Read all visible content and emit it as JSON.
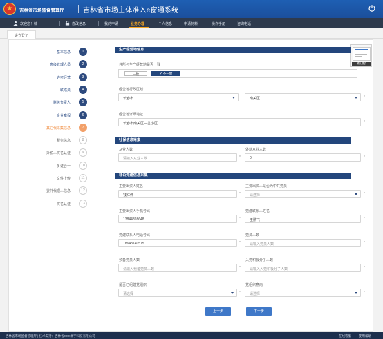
{
  "header": {
    "agency": "吉林省市场监督管理厅",
    "system": "吉林省市场主体准入e窗通系统"
  },
  "nav": {
    "welcome": "欢迎您！楠",
    "change_password": "修改信息",
    "items": [
      "我的申请",
      "业务办理",
      "个人信息",
      "申请材料",
      "操作手册",
      "咨询电话"
    ],
    "active_index": 1
  },
  "page_tab": "设立登记",
  "steps": [
    {
      "label": "基本信息",
      "num": "1",
      "state": "done"
    },
    {
      "label": "高级管理人员",
      "num": "2",
      "state": "done"
    },
    {
      "label": "许可经营",
      "num": "3",
      "state": "done"
    },
    {
      "label": "联络员",
      "num": "4",
      "state": "done"
    },
    {
      "label": "财务负责人",
      "num": "5",
      "state": "done"
    },
    {
      "label": "企业章程",
      "num": "6",
      "state": "done"
    },
    {
      "label": "其它代采集信息",
      "num": "7",
      "state": "current"
    },
    {
      "label": "税务信息",
      "num": "8",
      "state": "todo"
    },
    {
      "label": "办税人实名认证",
      "num": "9",
      "state": "todo"
    },
    {
      "label": "多证合一",
      "num": "10",
      "state": "todo"
    },
    {
      "label": "文件上传",
      "num": "11",
      "state": "todo"
    },
    {
      "label": "委托代理人信息",
      "num": "12",
      "state": "todo"
    },
    {
      "label": "实名认证",
      "num": "13",
      "state": "todo"
    }
  ],
  "sections": {
    "business_place": "生产经营地信息",
    "social": "社保信息采集",
    "party": "非公党建信息采集"
  },
  "form": {
    "same_address_label": "住所与生产经营地是否一致",
    "radio_no": "一致",
    "radio_yes": "✔ 不一致",
    "region_label": "经营地行政区划：",
    "region_city": "长春市",
    "region_district": "南关区",
    "detail_address_label": "经营地详细地址",
    "detail_address_value": "长春市南关区三岔小区",
    "employees_label": "从业人数",
    "employees_placeholder": "请输入从业人数",
    "foreign_employees_label": "外籍从业人数",
    "foreign_employees_value": "0",
    "investor_name_label": "主要出资人姓名",
    "investor_name_value": "钱红伟",
    "investor_party_label": "主要出资人是否为中共党员",
    "investor_party_placeholder": "请选择",
    "investor_phone_label": "主要出资人手机号码",
    "investor_phone_value": "13844898648",
    "party_contact_label": "党建联系人姓名",
    "party_contact_value": "王鹏飞",
    "party_contact_phone_label": "党建联系人电话号码",
    "party_contact_phone_value": "18643140575",
    "party_members_label": "党员人数",
    "party_members_placeholder": "请输入党员人数",
    "prob_members_label": "预备党员人数",
    "prob_members_placeholder": "请输入预备党员人数",
    "activists_label": "入党积极分子人数",
    "activists_placeholder": "请输入入党积极分子人数",
    "org_built_label": "是否已组建党组织",
    "org_built_placeholder": "请选择",
    "party_intent_label": "党组织意向",
    "party_intent_placeholder": "请选择",
    "required_mark": "*"
  },
  "buttons": {
    "prev": "上一步",
    "next": "下一步"
  },
  "widget": {
    "label": "确认提交"
  },
  "footer": {
    "copyright": "吉林省市场监督管理厅 | 技术支持：吉林省XXX数字科技有限公司",
    "item1": "在线客服",
    "item2": "使用帮助"
  }
}
